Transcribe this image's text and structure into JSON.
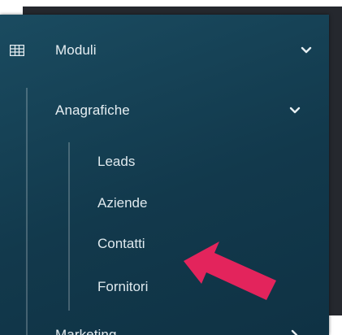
{
  "menu": {
    "root": {
      "label": "Moduli",
      "icon": "grid-icon",
      "expanded": true
    },
    "group": {
      "label": "Anagrafiche",
      "expanded": true
    },
    "items": [
      {
        "label": "Leads"
      },
      {
        "label": "Aziende"
      },
      {
        "label": "Contatti"
      },
      {
        "label": "Fornitori"
      }
    ],
    "next_group": {
      "label": "Marketing",
      "expanded": false
    }
  },
  "colors": {
    "panel": "#153f53",
    "text": "#e6eef2",
    "backdrop": "#25282e",
    "arrow": "#e3245c"
  }
}
